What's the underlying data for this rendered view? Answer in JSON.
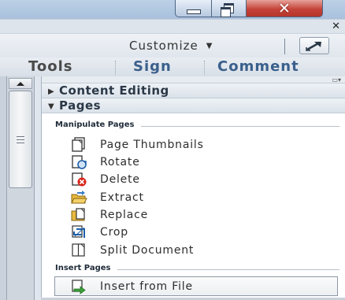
{
  "window": {
    "close_glyph": "✕"
  },
  "toolbar": {
    "pane_close_glyph": "✕",
    "customize_label": "Customize",
    "customize_caret": "▼"
  },
  "tabs": [
    {
      "label": "Tools"
    },
    {
      "label": "Sign"
    },
    {
      "label": "Comment"
    }
  ],
  "pane": {
    "menu_glyph": "▭▾",
    "sections": [
      {
        "label": "Content Editing",
        "arrow": "▶",
        "state": "collapsed"
      },
      {
        "label": "Pages",
        "arrow": "▼",
        "state": "expanded"
      }
    ],
    "groups": [
      {
        "label": "Manipulate Pages",
        "items": [
          {
            "label": "Page Thumbnails",
            "icon": "page-thumbnails-icon"
          },
          {
            "label": "Rotate",
            "icon": "rotate-icon"
          },
          {
            "label": "Delete",
            "icon": "delete-icon"
          },
          {
            "label": "Extract",
            "icon": "extract-icon"
          },
          {
            "label": "Replace",
            "icon": "replace-icon"
          },
          {
            "label": "Crop",
            "icon": "crop-icon"
          },
          {
            "label": "Split Document",
            "icon": "split-document-icon"
          }
        ]
      },
      {
        "label": "Insert Pages",
        "items": [
          {
            "label": "Insert from File",
            "icon": "insert-from-file-icon",
            "state": "hover"
          }
        ]
      }
    ]
  },
  "colors": {
    "tab_active": "#4a4a4a",
    "tab_link": "#3a5f8b",
    "close_button": "#c5433a",
    "delete_badge": "#d8261a",
    "insert_badge": "#3ca33a"
  }
}
